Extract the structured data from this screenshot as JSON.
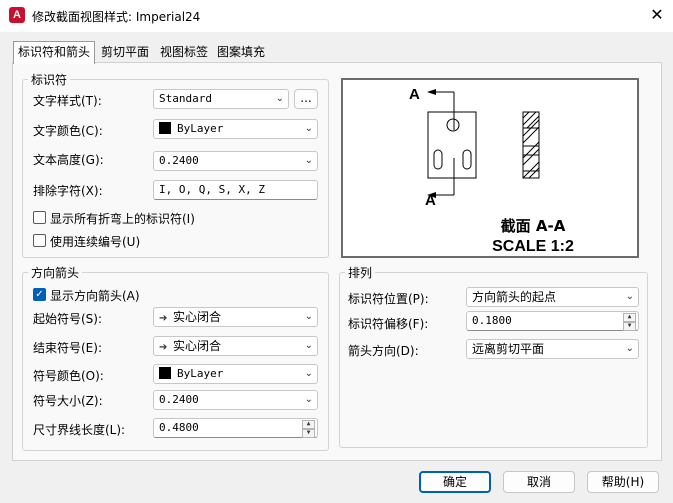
{
  "window": {
    "title": "修改截面视图样式: Imperial24",
    "close_glyph": "✕"
  },
  "tabs": [
    {
      "label": "标识符和箭头"
    },
    {
      "label": "剪切平面"
    },
    {
      "label": "视图标签"
    },
    {
      "label": "图案填充"
    }
  ],
  "identifier": {
    "group_title": "标识符",
    "text_style_label": "文字样式(T):",
    "text_style_value": "Standard",
    "browse_label": "...",
    "text_color_label": "文字颜色(C):",
    "text_color_value": "ByLayer",
    "text_height_label": "文本高度(G):",
    "text_height_value": "0.2400",
    "exclude_label": "排除字符(X):",
    "exclude_value": "I, O, Q, S, X, Z",
    "show_all_bends_label": "显示所有折弯上的标识符(I)",
    "continuous_label": "使用连续编号(U)"
  },
  "arrows": {
    "group_title": "方向箭头",
    "show_arrows_label": "显示方向箭头(A)",
    "start_symbol_label": "起始符号(S):",
    "start_symbol_value": "实心闭合",
    "end_symbol_label": "结束符号(E):",
    "end_symbol_value": "实心闭合",
    "symbol_color_label": "符号颜色(O):",
    "symbol_color_value": "ByLayer",
    "symbol_size_label": "符号大小(Z):",
    "symbol_size_value": "0.2400",
    "ext_length_label": "尺寸界线长度(L):",
    "ext_length_value": "0.4800"
  },
  "preview": {
    "letter_top": "A",
    "letter_bottom": "A",
    "section_title": "截面 A-A",
    "scale_text": "SCALE 1:2"
  },
  "layout": {
    "group_title": "排列",
    "id_position_label": "标识符位置(P):",
    "id_position_value": "方向箭头的起点",
    "id_offset_label": "标识符偏移(F):",
    "id_offset_value": "0.1800",
    "arrow_direction_label": "箭头方向(D):",
    "arrow_direction_value": "远离剪切平面"
  },
  "buttons": {
    "ok": "确定",
    "cancel": "取消",
    "help": "帮助(H)"
  },
  "icons": {
    "app": "A",
    "chevron": "⌄",
    "arrow": "➔",
    "check": "✓",
    "up": "▲",
    "down": "▼"
  },
  "colors": {
    "accent": "#005fb8",
    "app_icon": "#c8102e"
  }
}
